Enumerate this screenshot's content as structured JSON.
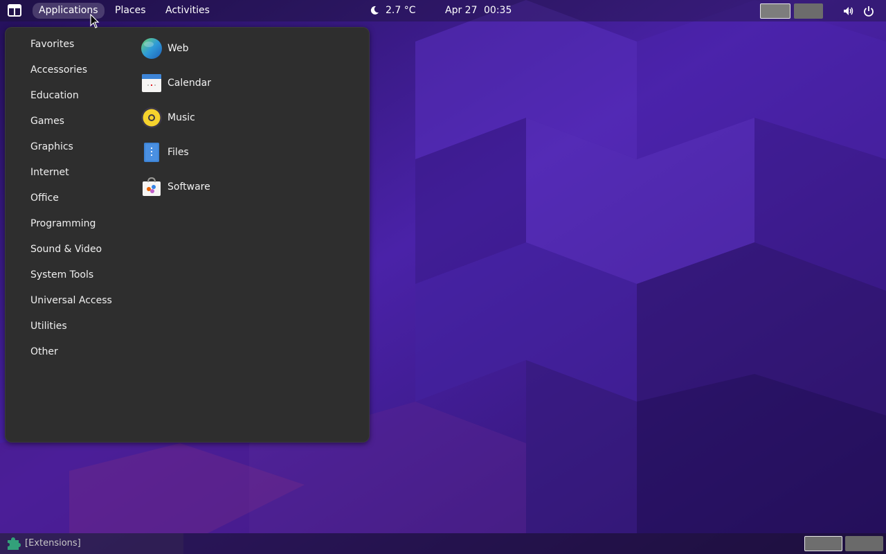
{
  "topbar": {
    "menus": [
      {
        "label": "Applications",
        "active": true
      },
      {
        "label": "Places",
        "active": false
      },
      {
        "label": "Activities",
        "active": false
      }
    ],
    "weather": {
      "icon": "moon-icon",
      "temperature": "2.7 °C"
    },
    "clock": {
      "date": "Apr 27",
      "time": "00:35"
    },
    "tray": {
      "volume_icon": "volume-icon",
      "power_icon": "power-icon"
    }
  },
  "app_menu": {
    "categories": [
      "Favorites",
      "Accessories",
      "Education",
      "Games",
      "Graphics",
      "Internet",
      "Office",
      "Programming",
      "Sound & Video",
      "System Tools",
      "Universal Access",
      "Utilities",
      "Other"
    ],
    "apps": [
      {
        "label": "Web",
        "icon": "web-browser-icon"
      },
      {
        "label": "Calendar",
        "icon": "calendar-icon"
      },
      {
        "label": "Music",
        "icon": "music-icon"
      },
      {
        "label": "Files",
        "icon": "files-icon"
      },
      {
        "label": "Software",
        "icon": "software-icon"
      }
    ]
  },
  "bottombar": {
    "extensions_label": "[Extensions]",
    "extensions_icon": "puzzle-icon"
  },
  "colors": {
    "menu_bg": "#2e2e2e",
    "wallpaper_base": "#3b1a82",
    "accent_blue": "#3d84d6"
  }
}
